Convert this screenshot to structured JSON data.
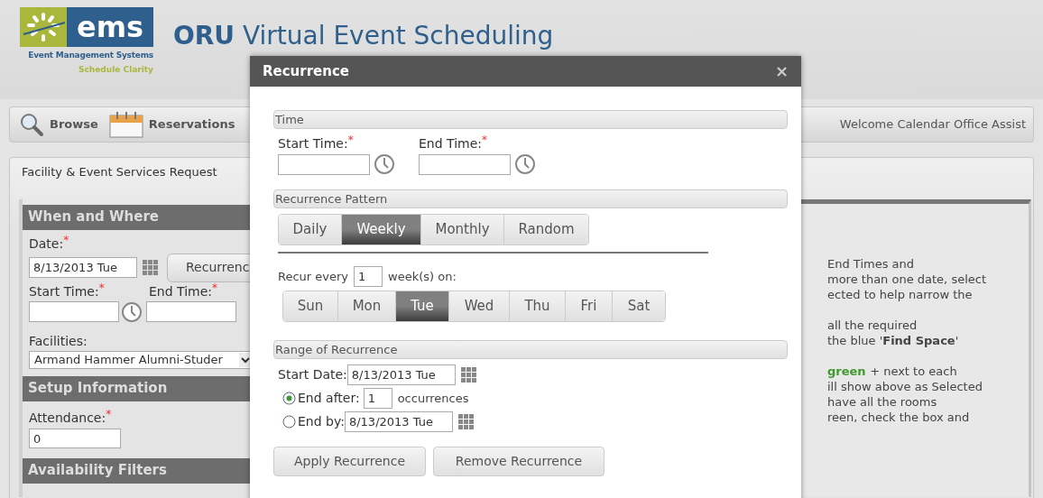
{
  "header": {
    "logo": {
      "wordmark": "ems",
      "line1": "Event Management Systems",
      "line2": "Schedule Clarity"
    },
    "title_bold": "ORU",
    "title": "Virtual Event Scheduling"
  },
  "nav": {
    "items": [
      {
        "label": "Browse",
        "kind": "search"
      },
      {
        "label": "Reservations",
        "kind": "calendar"
      }
    ],
    "welcome": "Welcome Calendar Office Assist"
  },
  "request": {
    "title": "Facility & Event Services Request",
    "when_where": {
      "heading": "When and Where",
      "date_label": "Date:",
      "date_mark": "*",
      "date_value": "8/13/2013 Tue",
      "recurrence_button": "Recurrenc",
      "start_label": "Start Time:",
      "start_mark": "*",
      "end_label": "End Time:",
      "end_mark": "*",
      "facilities_label": "Facilities:",
      "facilities_value": "Armand Hammer Alumni-Studer"
    },
    "setup": {
      "heading": "Setup Information",
      "attendance_label": "Attendance:",
      "attendance_mark": "*",
      "attendance_value": "0"
    },
    "filters": {
      "heading": "Availability Filters"
    },
    "help_lines": [
      {
        "text": "End Times and"
      },
      {
        "text": "more than one date, select"
      },
      {
        "text": "ected to help narrow the"
      },
      {
        "text": "all the required",
        "gap": true
      },
      {
        "text": "the blue '**Find Space**'"
      },
      {
        "text": "+ next to each",
        "gap": true,
        "lead": "green"
      },
      {
        "text": "ill show above as Selected"
      },
      {
        "text": "have all the rooms"
      },
      {
        "text": "reen, check the box and"
      }
    ]
  },
  "dialog": {
    "title": "Recurrence",
    "close": "×",
    "time": {
      "heading": "Time",
      "start_label": "Start Time:",
      "start_mark": "*",
      "end_label": "End Time:",
      "end_mark": "*"
    },
    "pattern": {
      "heading": "Recurrence Pattern",
      "tabs": [
        {
          "label": "Daily",
          "selected": false
        },
        {
          "label": "Weekly",
          "selected": true
        },
        {
          "label": "Monthly",
          "selected": false
        },
        {
          "label": "Random",
          "selected": false
        }
      ],
      "recur_label": "Recur every",
      "recur_value": "1",
      "recur_unit": "week(s) on:",
      "days": [
        {
          "label": "Sun",
          "selected": false
        },
        {
          "label": "Mon",
          "selected": false
        },
        {
          "label": "Tue",
          "selected": true
        },
        {
          "label": "Wed",
          "selected": false
        },
        {
          "label": "Thu",
          "selected": false
        },
        {
          "label": "Fri",
          "selected": false
        },
        {
          "label": "Sat",
          "selected": false
        }
      ]
    },
    "range": {
      "heading": "Range of Recurrence",
      "start_label": "Start Date:",
      "start_value": "8/13/2013 Tue",
      "end_after": {
        "label": "End after:",
        "selected": true,
        "value": "1",
        "unit": "occurrences"
      },
      "end_by": {
        "label": "End by:",
        "selected": false,
        "value": "8/13/2013 Tue"
      }
    },
    "buttons": [
      "Apply Recurrence",
      "Remove Recurrence"
    ]
  }
}
